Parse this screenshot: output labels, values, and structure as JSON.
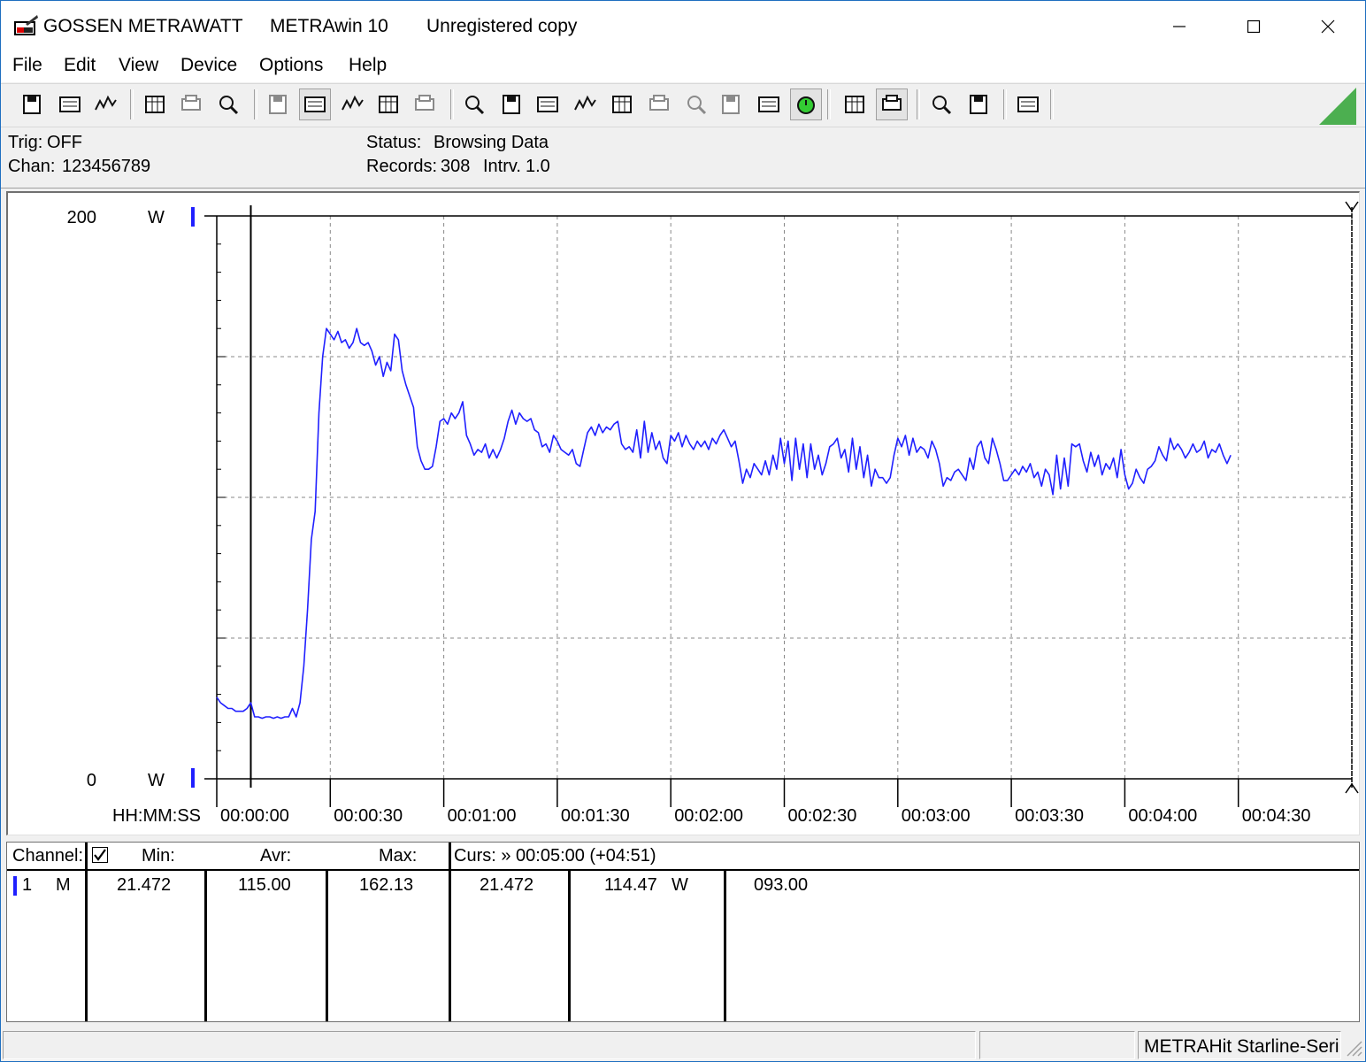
{
  "title": {
    "brand": "GOSSEN METRAWATT",
    "app": "METRAwin 10",
    "registration": "Unregistered copy"
  },
  "window_controls": {
    "minimize": "–",
    "maximize": "☐",
    "close": "✕"
  },
  "menu": [
    {
      "label": "File"
    },
    {
      "label": "Edit"
    },
    {
      "label": "View"
    },
    {
      "label": "Device"
    },
    {
      "label": "Options"
    },
    {
      "label": "Help"
    }
  ],
  "toolbar": {
    "icons": [
      "save-icon",
      "save-as-icon",
      "open-icon",
      "device-read-icon",
      "device-config-icon",
      "device-write-icon",
      "numeric-display-icon",
      "graph-view-icon",
      "xy-view-icon",
      "table-view-icon",
      "histogram-icon",
      "import-icon",
      "export-icon",
      "list-icon",
      "monitor-icon",
      "formula-icon",
      "calculator-icon",
      "signal-icon",
      "signal-alt-icon",
      "search-data-icon",
      "timer-icon",
      "print-icon",
      "print-preview-icon",
      "zoom-icon",
      "zoom-tool-icon",
      "comment-icon"
    ]
  },
  "status": {
    "trig_label": "Trig:",
    "trig_value": "OFF",
    "chan_label": "Chan:",
    "chan_value": "123456789",
    "status_label": "Status:",
    "status_value": "Browsing Data",
    "records_label": "Records:",
    "records_value": "308",
    "interval_label": "Intrv.",
    "interval_value": "1.0"
  },
  "chart_data": {
    "type": "line",
    "y_top_label": "200",
    "y_bottom_label": "0",
    "y_unit": "W",
    "x_axis_label": "HH:MM:SS",
    "ylim": [
      0,
      200
    ],
    "x_unit": "seconds",
    "xlim": [
      0,
      300
    ],
    "grid": true,
    "x_tick_labels": [
      "00:00:00",
      "00:00:30",
      "00:01:00",
      "00:01:30",
      "00:02:00",
      "00:02:30",
      "00:03:00",
      "00:03:30",
      "00:04:00",
      "00:04:30"
    ],
    "series_color": "#2020ff",
    "series": [
      {
        "values": [
          [
            0,
            29
          ],
          [
            1,
            27
          ],
          [
            2,
            26
          ],
          [
            3,
            25
          ],
          [
            4,
            25
          ],
          [
            5,
            24
          ],
          [
            6,
            24
          ],
          [
            7,
            24
          ],
          [
            8,
            25
          ],
          [
            9,
            27
          ],
          [
            10,
            22
          ],
          [
            11,
            22
          ],
          [
            12,
            21.5
          ],
          [
            13,
            22
          ],
          [
            14,
            22
          ],
          [
            15,
            21.5
          ],
          [
            16,
            22
          ],
          [
            17,
            21.5
          ],
          [
            18,
            22
          ],
          [
            19,
            22
          ],
          [
            20,
            25
          ],
          [
            21,
            22
          ],
          [
            22,
            27
          ],
          [
            23,
            40
          ],
          [
            24,
            60
          ],
          [
            25,
            85
          ],
          [
            26,
            95
          ],
          [
            27,
            130
          ],
          [
            28,
            150
          ],
          [
            29,
            160
          ],
          [
            30,
            158
          ],
          [
            31,
            156
          ],
          [
            32,
            159
          ],
          [
            33,
            155
          ],
          [
            34,
            156
          ],
          [
            35,
            153
          ],
          [
            36,
            155
          ],
          [
            37,
            160
          ],
          [
            38,
            155
          ],
          [
            39,
            154
          ],
          [
            40,
            155
          ],
          [
            41,
            152
          ],
          [
            42,
            147
          ],
          [
            43,
            150
          ],
          [
            44,
            143
          ],
          [
            45,
            148
          ],
          [
            46,
            145
          ],
          [
            47,
            158
          ],
          [
            48,
            156
          ],
          [
            49,
            145
          ],
          [
            50,
            140
          ],
          [
            51,
            136
          ],
          [
            52,
            132
          ],
          [
            53,
            118
          ],
          [
            54,
            113
          ],
          [
            55,
            110
          ],
          [
            56,
            110
          ],
          [
            57,
            111
          ],
          [
            58,
            118
          ],
          [
            59,
            127
          ],
          [
            60,
            128
          ],
          [
            61,
            126
          ],
          [
            62,
            130
          ],
          [
            63,
            128
          ],
          [
            64,
            130
          ],
          [
            65,
            134
          ],
          [
            66,
            122
          ],
          [
            67,
            119
          ],
          [
            68,
            115
          ],
          [
            69,
            117
          ],
          [
            70,
            116
          ],
          [
            71,
            119
          ],
          [
            72,
            114
          ],
          [
            73,
            117
          ],
          [
            74,
            114
          ],
          [
            75,
            117
          ],
          [
            76,
            121
          ],
          [
            77,
            127
          ],
          [
            78,
            131
          ],
          [
            79,
            126
          ],
          [
            80,
            130
          ],
          [
            81,
            128
          ],
          [
            82,
            127
          ],
          [
            83,
            128
          ],
          [
            84,
            124
          ],
          [
            85,
            123
          ],
          [
            86,
            118
          ],
          [
            87,
            119
          ],
          [
            88,
            116
          ],
          [
            89,
            122
          ],
          [
            90,
            120
          ],
          [
            91,
            117
          ],
          [
            92,
            116
          ],
          [
            93,
            115
          ],
          [
            94,
            117
          ],
          [
            95,
            112
          ],
          [
            96,
            111
          ],
          [
            97,
            117
          ],
          [
            98,
            123
          ],
          [
            99,
            125
          ],
          [
            100,
            122
          ],
          [
            101,
            126
          ],
          [
            102,
            123
          ],
          [
            103,
            125
          ],
          [
            104,
            124
          ],
          [
            105,
            126
          ],
          [
            106,
            127
          ],
          [
            107,
            119
          ],
          [
            108,
            117
          ],
          [
            109,
            118
          ],
          [
            110,
            116
          ],
          [
            111,
            124
          ],
          [
            112,
            114
          ],
          [
            113,
            127
          ],
          [
            114,
            116
          ],
          [
            115,
            123
          ],
          [
            116,
            117
          ],
          [
            117,
            120
          ],
          [
            118,
            114
          ],
          [
            119,
            112
          ],
          [
            120,
            122
          ],
          [
            121,
            120
          ],
          [
            122,
            123
          ],
          [
            123,
            118
          ],
          [
            124,
            122
          ],
          [
            125,
            119
          ],
          [
            126,
            117
          ],
          [
            127,
            120
          ],
          [
            128,
            118
          ],
          [
            129,
            120
          ],
          [
            130,
            117
          ],
          [
            131,
            121
          ],
          [
            132,
            119
          ],
          [
            133,
            122
          ],
          [
            134,
            124
          ],
          [
            135,
            121
          ],
          [
            136,
            118
          ],
          [
            137,
            120
          ],
          [
            138,
            113
          ],
          [
            139,
            105
          ],
          [
            140,
            110
          ],
          [
            141,
            107
          ],
          [
            142,
            112
          ],
          [
            143,
            110
          ],
          [
            144,
            108
          ],
          [
            145,
            113
          ],
          [
            146,
            108
          ],
          [
            147,
            115
          ],
          [
            148,
            110
          ],
          [
            149,
            121
          ],
          [
            150,
            112
          ],
          [
            151,
            120
          ],
          [
            152,
            106
          ],
          [
            153,
            121
          ],
          [
            154,
            110
          ],
          [
            155,
            119
          ],
          [
            156,
            107
          ],
          [
            157,
            119
          ],
          [
            158,
            110
          ],
          [
            159,
            115
          ],
          [
            160,
            108
          ],
          [
            161,
            112
          ],
          [
            162,
            118
          ],
          [
            163,
            119
          ],
          [
            164,
            121
          ],
          [
            165,
            114
          ],
          [
            166,
            117
          ],
          [
            167,
            109
          ],
          [
            168,
            121
          ],
          [
            169,
            110
          ],
          [
            170,
            118
          ],
          [
            171,
            107
          ],
          [
            172,
            115
          ],
          [
            173,
            104
          ],
          [
            174,
            110
          ],
          [
            175,
            107
          ],
          [
            176,
            107
          ],
          [
            177,
            105
          ],
          [
            178,
            107
          ],
          [
            179,
            115
          ],
          [
            180,
            121
          ],
          [
            181,
            118
          ],
          [
            182,
            122
          ],
          [
            183,
            115
          ],
          [
            184,
            121
          ],
          [
            185,
            116
          ],
          [
            186,
            118
          ],
          [
            187,
            117
          ],
          [
            188,
            114
          ],
          [
            189,
            120
          ],
          [
            190,
            117
          ],
          [
            191,
            112
          ],
          [
            192,
            104
          ],
          [
            193,
            107
          ],
          [
            194,
            106
          ],
          [
            195,
            109
          ],
          [
            196,
            110
          ],
          [
            197,
            108
          ],
          [
            198,
            106
          ],
          [
            199,
            114
          ],
          [
            200,
            110
          ],
          [
            201,
            118
          ],
          [
            202,
            120
          ],
          [
            203,
            114
          ],
          [
            204,
            112
          ],
          [
            205,
            121
          ],
          [
            206,
            117
          ],
          [
            207,
            112
          ],
          [
            208,
            106
          ],
          [
            209,
            106
          ],
          [
            210,
            108
          ],
          [
            211,
            110
          ],
          [
            212,
            108
          ],
          [
            213,
            111
          ],
          [
            214,
            109
          ],
          [
            215,
            112
          ],
          [
            216,
            107
          ],
          [
            217,
            109
          ],
          [
            218,
            104
          ],
          [
            219,
            110
          ],
          [
            220,
            108
          ],
          [
            221,
            101
          ],
          [
            222,
            115
          ],
          [
            223,
            103
          ],
          [
            224,
            114
          ],
          [
            225,
            104
          ],
          [
            226,
            119
          ],
          [
            227,
            118
          ],
          [
            228,
            119
          ],
          [
            229,
            113
          ],
          [
            230,
            109
          ],
          [
            231,
            116
          ],
          [
            232,
            111
          ],
          [
            233,
            115
          ],
          [
            234,
            108
          ],
          [
            235,
            112
          ],
          [
            236,
            110
          ],
          [
            237,
            114
          ],
          [
            238,
            107
          ],
          [
            239,
            117
          ],
          [
            240,
            108
          ],
          [
            241,
            103
          ],
          [
            242,
            105
          ],
          [
            243,
            110
          ],
          [
            244,
            107
          ],
          [
            245,
            105
          ],
          [
            246,
            110
          ],
          [
            247,
            111
          ],
          [
            248,
            113
          ],
          [
            249,
            118
          ],
          [
            250,
            115
          ],
          [
            251,
            113
          ],
          [
            252,
            121
          ],
          [
            253,
            117
          ],
          [
            254,
            119
          ],
          [
            255,
            117
          ],
          [
            256,
            114
          ],
          [
            257,
            116
          ],
          [
            258,
            119
          ],
          [
            259,
            116
          ],
          [
            260,
            117
          ],
          [
            261,
            120
          ],
          [
            262,
            114
          ],
          [
            263,
            117
          ],
          [
            264,
            116
          ],
          [
            265,
            119
          ],
          [
            266,
            115
          ],
          [
            267,
            112
          ],
          [
            268,
            115
          ]
        ]
      }
    ]
  },
  "table": {
    "headers": {
      "channel": "Channel:",
      "min": "Min:",
      "avr": "Avr:",
      "max": "Max:",
      "curs": "Curs: » 00:05:00 (+04:51)"
    },
    "rows": [
      {
        "ch_num": "1",
        "ch_mode": "M",
        "min": "21.472",
        "avr": "115.00",
        "max": "162.13",
        "cursor_value": "21.472",
        "cursor_value2": "114.47",
        "unit": "W",
        "extra": "093.00"
      }
    ]
  },
  "statusbar": {
    "device": "METRAHit Starline-Seri"
  }
}
